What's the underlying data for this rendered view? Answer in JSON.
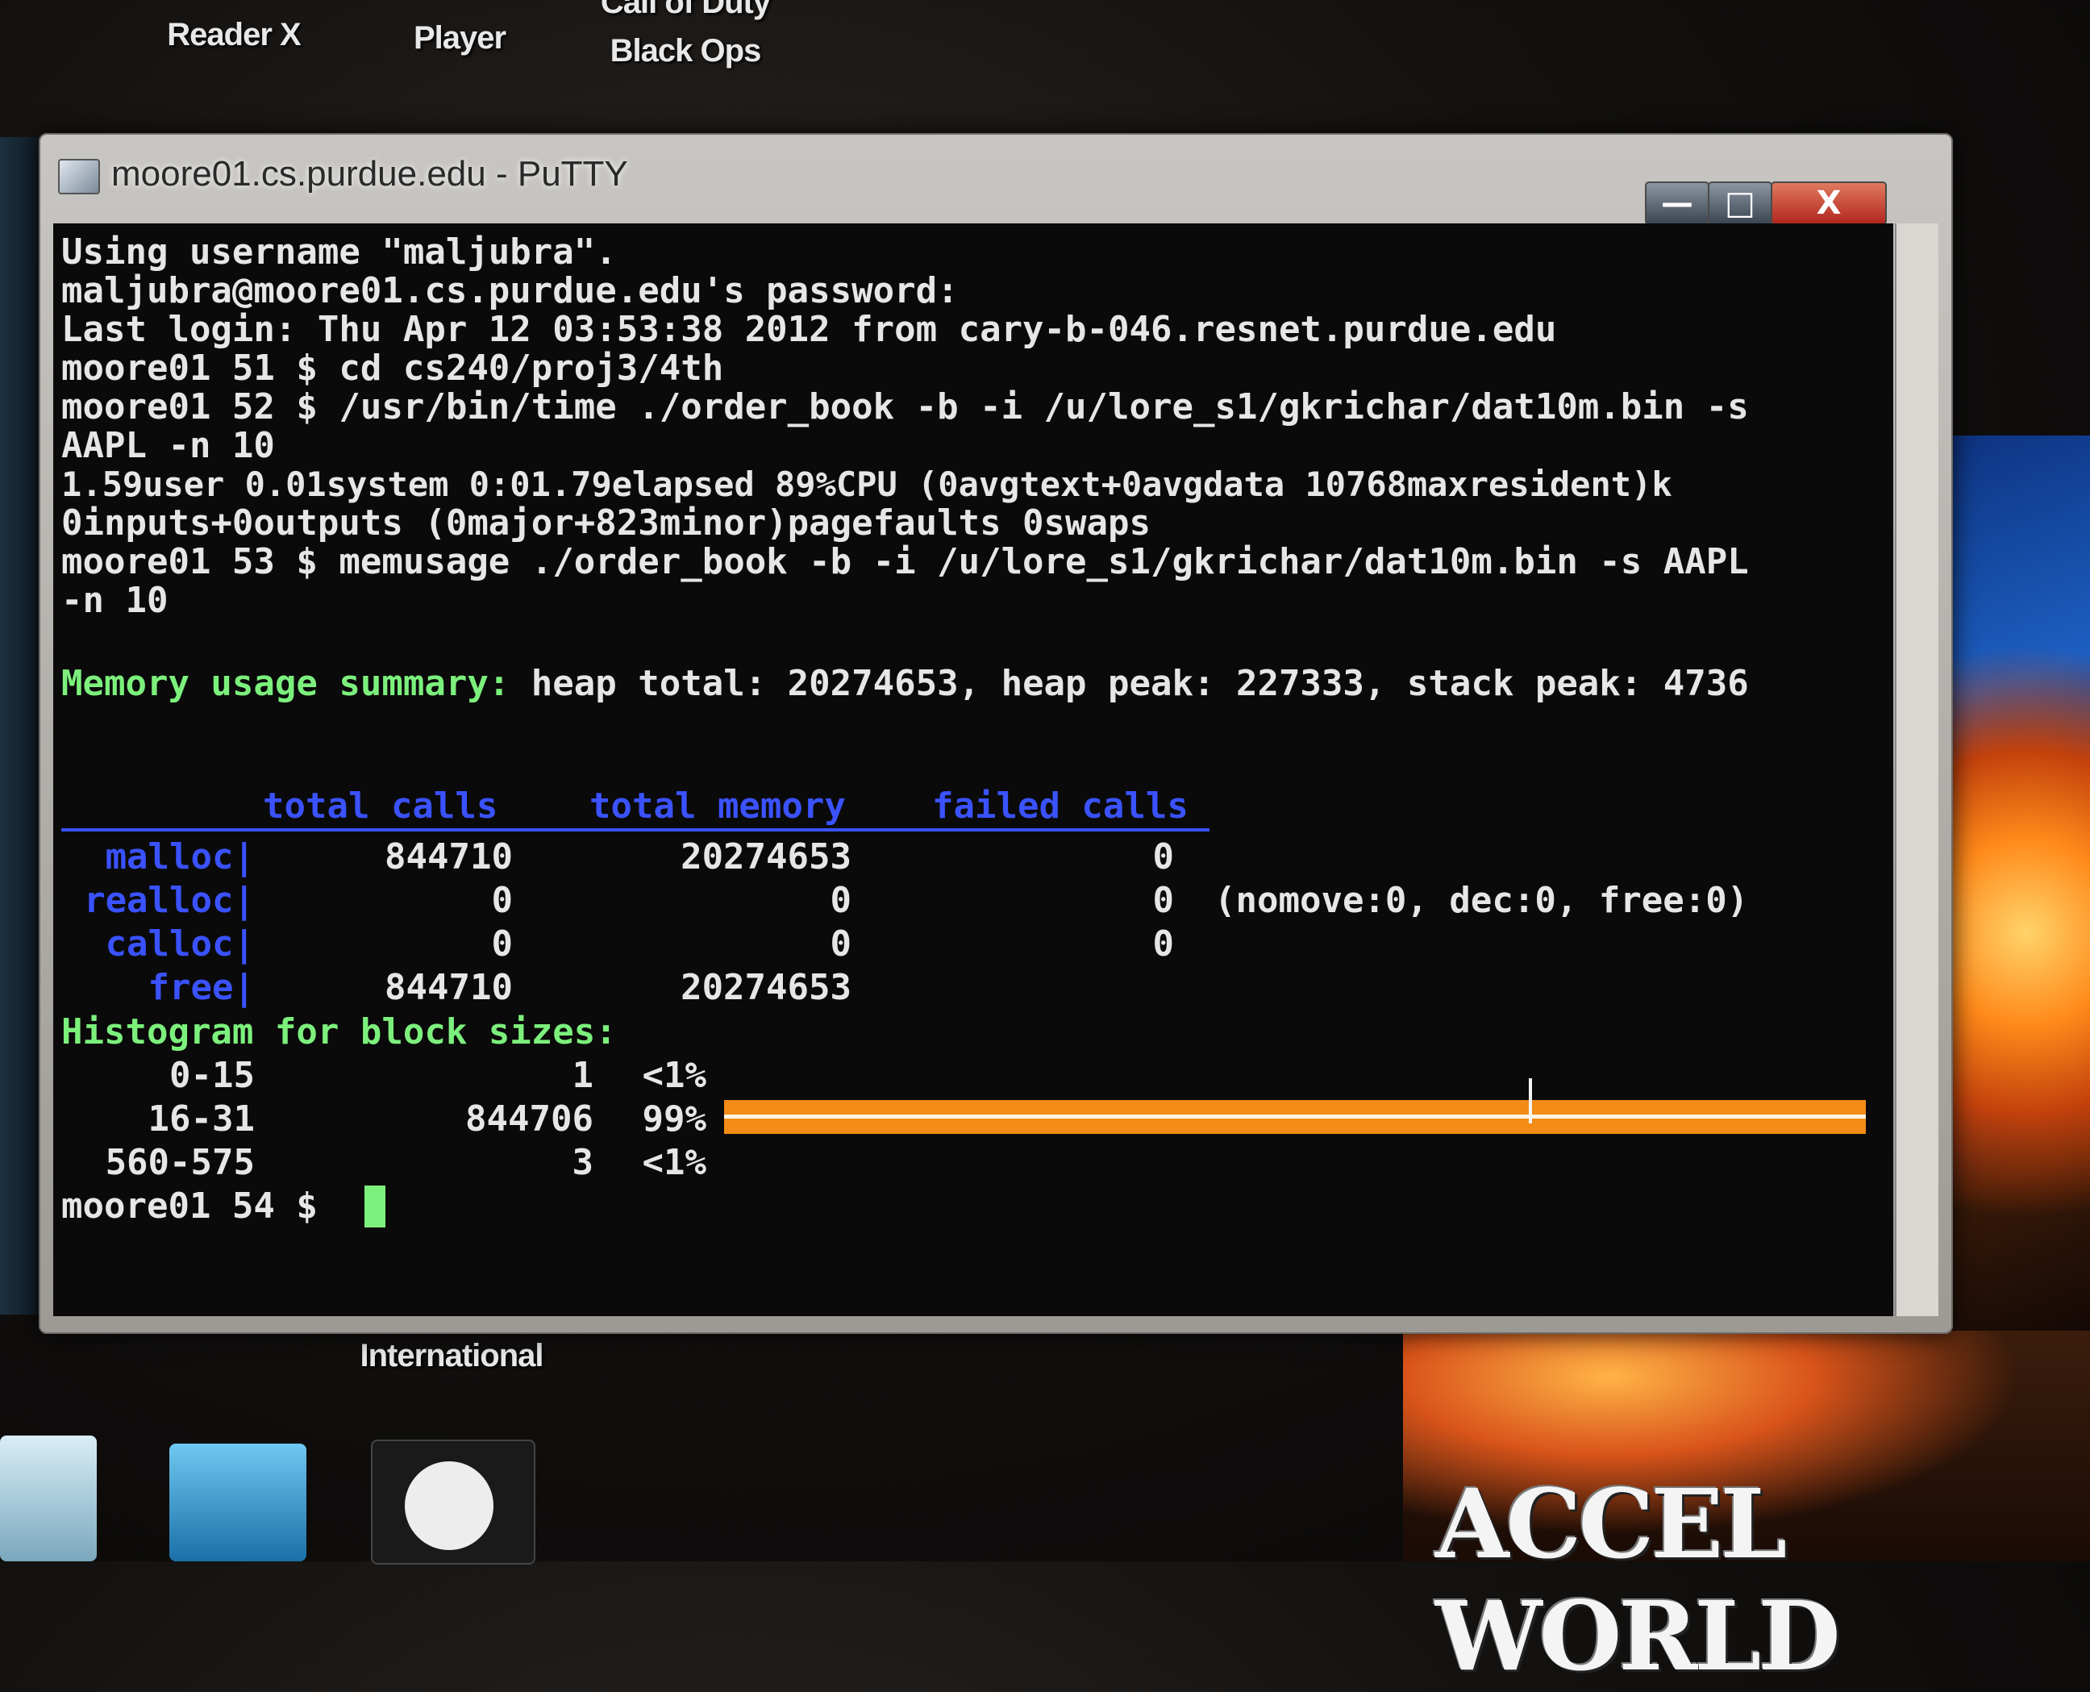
{
  "desktop": {
    "icons": [
      {
        "label_line1": "Reader X",
        "label_line2": ""
      },
      {
        "label_line1": "Player",
        "label_line2": ""
      },
      {
        "label_line1": "Call of Duty",
        "label_line2": "Black Ops"
      },
      {
        "label_line1": "International",
        "label_line2": ""
      }
    ],
    "wallpaper_text": "ACCEL WORLD"
  },
  "window": {
    "title": "moore01.cs.purdue.edu - PuTTY",
    "controls": {
      "minimize": "—",
      "maximize": "□",
      "close": "X"
    }
  },
  "terminal": {
    "lines": [
      "Using username \"maljubra\".",
      "maljubra@moore01.cs.purdue.edu's password:",
      "Last login: Thu Apr 12 03:53:38 2012 from cary-b-046.resnet.purdue.edu",
      "moore01 51 $ cd cs240/proj3/4th",
      "moore01 52 $ /usr/bin/time ./order_book -b -i /u/lore_s1/gkrichar/dat10m.bin -s",
      "AAPL -n 10",
      "1.59user 0.01system 0:01.79elapsed 89%CPU (0avgtext+0avgdata 10768maxresident)k",
      "0inputs+0outputs (0major+823minor)pagefaults 0swaps",
      "moore01 53 $ memusage ./order_book -b -i /u/lore_s1/gkrichar/dat10m.bin -s AAPL",
      "-n 10"
    ],
    "summary_label": "Memory usage summary:",
    "summary_text": " heap total: 20274653, heap peak: 227333, stack peak: 4736",
    "table_headers": [
      "total calls",
      "total memory",
      "failed calls"
    ],
    "table_rows": [
      {
        "fn": "malloc|",
        "calls": "844710",
        "memory": "20274653",
        "failed": "0",
        "extra": ""
      },
      {
        "fn": "realloc|",
        "calls": "0",
        "memory": "0",
        "failed": "0",
        "extra": "(nomove:0, dec:0, free:0)"
      },
      {
        "fn": "calloc|",
        "calls": "0",
        "memory": "0",
        "failed": "0",
        "extra": ""
      },
      {
        "fn": "free|",
        "calls": "844710",
        "memory": "20274653",
        "failed": "",
        "extra": ""
      }
    ],
    "histogram_label": "Histogram for block sizes:",
    "histogram": [
      {
        "range": "0-15",
        "count": "1",
        "pct": "<1%",
        "fill": 0
      },
      {
        "range": "16-31",
        "count": "844706",
        "pct": "99%",
        "fill": 0.99
      },
      {
        "range": "560-575",
        "count": "3",
        "pct": "<1%",
        "fill": 0
      }
    ],
    "prompt": "moore01 54 $ ",
    "colors": {
      "green": "#7cf07c",
      "blue": "#3a52ff",
      "bar": "#f28c16"
    }
  }
}
